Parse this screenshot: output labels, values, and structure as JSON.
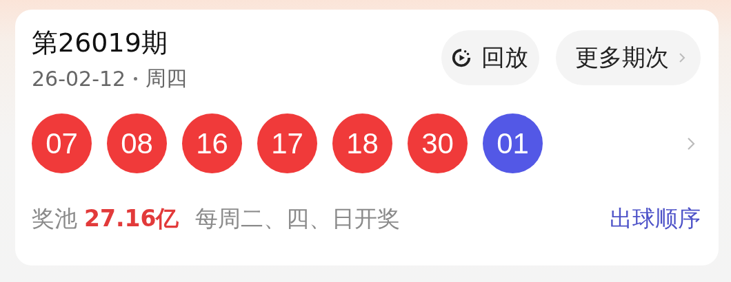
{
  "draw": {
    "title": "第26019期",
    "date": "26-02-12",
    "weekday": "周四"
  },
  "buttons": {
    "replay": "回放",
    "more": "更多期次"
  },
  "balls": [
    {
      "number": "07",
      "color": "#f03a3a"
    },
    {
      "number": "08",
      "color": "#f03a3a"
    },
    {
      "number": "16",
      "color": "#f03a3a"
    },
    {
      "number": "17",
      "color": "#f03a3a"
    },
    {
      "number": "18",
      "color": "#f03a3a"
    },
    {
      "number": "30",
      "color": "#f03a3a"
    },
    {
      "number": "01",
      "color": "#5358e6"
    }
  ],
  "footer": {
    "pool_label": "奖池",
    "pool_amount": "27.16亿",
    "schedule": "每周二、四、日开奖",
    "order_link": "出球顺序"
  }
}
